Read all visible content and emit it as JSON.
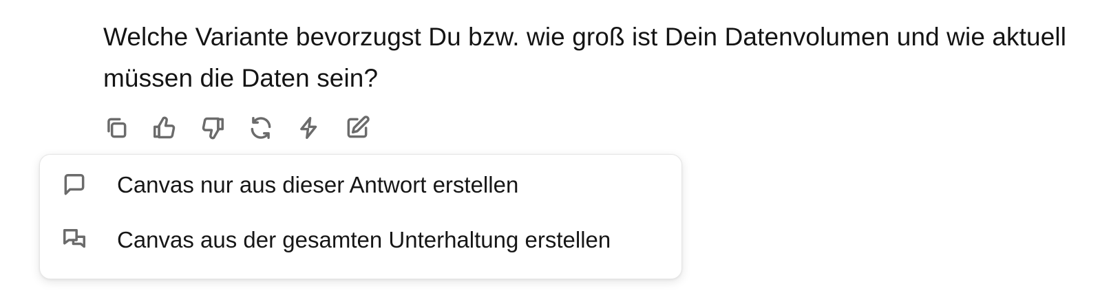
{
  "message": {
    "text": "Welche Variante bevorzugst Du bzw. wie groß ist Dein Datenvolumen und wie aktuell müssen die Daten sein?"
  },
  "toolbar": {
    "icons": [
      "copy-icon",
      "thumbs-up-icon",
      "thumbs-down-icon",
      "regenerate-icon",
      "lightning-icon",
      "edit-icon"
    ]
  },
  "canvas_menu": {
    "items": [
      {
        "label": "Canvas nur aus dieser Antwort erstellen",
        "icon": "speech-bubble-icon"
      },
      {
        "label": "Canvas aus der gesamten Unterhaltung erstellen",
        "icon": "conversation-bubbles-icon"
      }
    ]
  },
  "colors": {
    "text": "#141414",
    "icon": "#6b6b6b",
    "menu_border": "#e6e6e6",
    "background": "#ffffff"
  }
}
